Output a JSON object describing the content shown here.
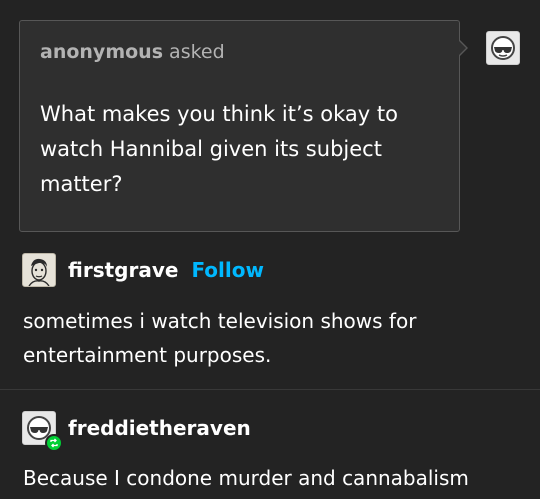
{
  "ask": {
    "asker": "anonymous",
    "asked_word": "asked",
    "question": "What makes you think it’s okay to watch Hannibal given its subject matter?"
  },
  "reply": {
    "username": "firstgrave",
    "follow_label": "Follow",
    "text": "sometimes i watch television shows for entertainment purposes."
  },
  "reblog": {
    "username": "freddietheraven",
    "text": "Because I condone murder and cannabalism"
  },
  "colors": {
    "background": "#232323",
    "ask_bubble": "#2f2f2f",
    "follow_link": "#00b8ff",
    "reblog_badge": "#00cf35"
  },
  "icons": [
    "anonymous-avatar-icon",
    "sketch-avatar-icon",
    "sunglasses-avatar-icon",
    "reblog-icon"
  ]
}
